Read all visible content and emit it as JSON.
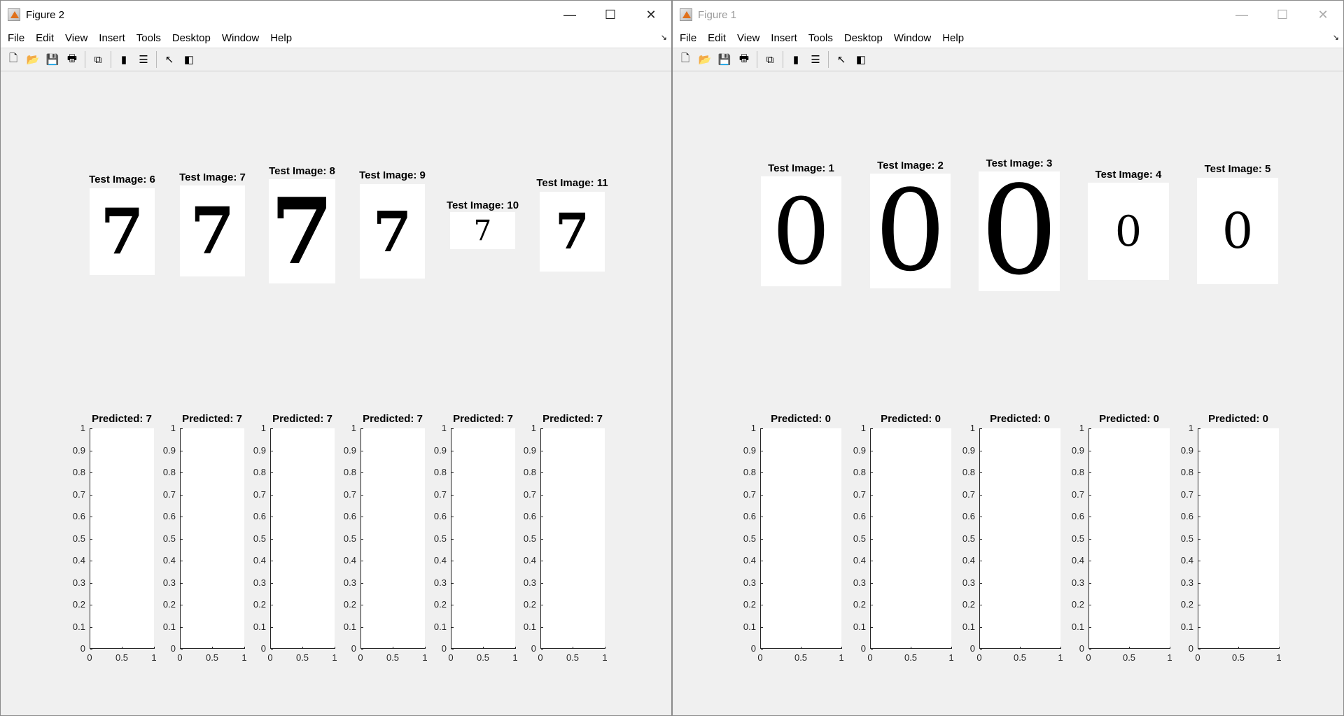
{
  "menu_items": [
    "File",
    "Edit",
    "View",
    "Insert",
    "Tools",
    "Desktop",
    "Window",
    "Help"
  ],
  "toolbar_icons": [
    "new-figure-icon",
    "open-file-icon",
    "save-icon",
    "print-icon",
    "link-plot-icon",
    "colorbar-icon",
    "legend-icon",
    "pointer-icon",
    "property-editor-icon"
  ],
  "window_controls": [
    "minimize",
    "maximize",
    "close"
  ],
  "windows": [
    {
      "title": "Figure 2",
      "active": true,
      "images": [
        {
          "title": "Test Image: 6",
          "digit": "7"
        },
        {
          "title": "Test Image: 7",
          "digit": "7"
        },
        {
          "title": "Test Image: 8",
          "digit": "7"
        },
        {
          "title": "Test Image: 9",
          "digit": "7"
        },
        {
          "title": "Test Image: 10",
          "digit": "7"
        },
        {
          "title": "Test Image: 11",
          "digit": "7"
        }
      ],
      "predictions": [
        "Predicted: 7",
        "Predicted: 7",
        "Predicted: 7",
        "Predicted: 7",
        "Predicted: 7",
        "Predicted: 7"
      ]
    },
    {
      "title": "Figure 1",
      "active": false,
      "images": [
        {
          "title": "Test Image: 1",
          "digit": "0"
        },
        {
          "title": "Test Image: 2",
          "digit": "0"
        },
        {
          "title": "Test Image: 3",
          "digit": "0"
        },
        {
          "title": "Test Image: 4",
          "digit": "0"
        },
        {
          "title": "Test Image: 5",
          "digit": "0"
        }
      ],
      "predictions": [
        "Predicted: 0",
        "Predicted: 0",
        "Predicted: 0",
        "Predicted: 0",
        "Predicted: 0"
      ]
    }
  ],
  "chart_data": {
    "type": "line",
    "xlim": [
      0,
      1
    ],
    "ylim": [
      0,
      1
    ],
    "xticks": [
      "0",
      "0.5",
      "1"
    ],
    "yticks": [
      "0",
      "0.1",
      "0.2",
      "0.3",
      "0.4",
      "0.5",
      "0.6",
      "0.7",
      "0.8",
      "0.9",
      "1"
    ],
    "series": []
  }
}
